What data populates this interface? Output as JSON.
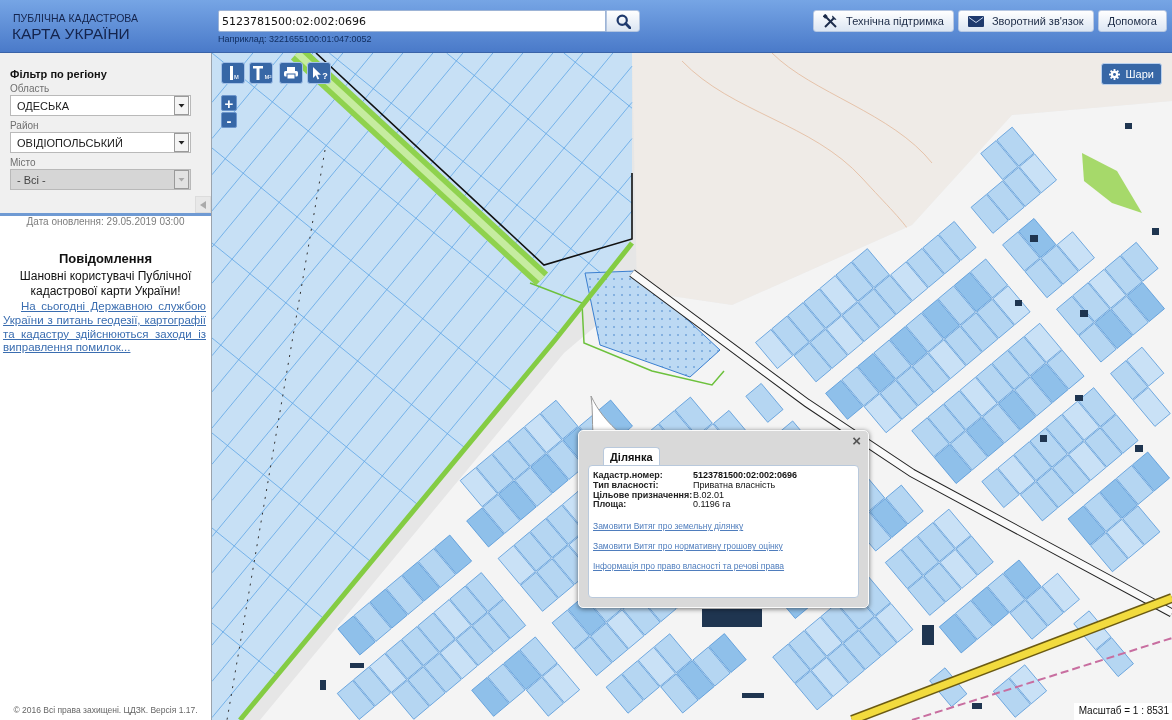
{
  "header": {
    "logo": {
      "line_1": "ПУБЛІЧНА КАДАСТРОВА",
      "line_2": "КАРТА УКРАЇНИ"
    },
    "search": {
      "value": "5123781500:02:002:0696",
      "hint": "Наприклад: 3221655100:01:047:0052"
    },
    "buttons": [
      {
        "kind": "tools",
        "label": "Технічна підтримка"
      },
      {
        "kind": "mail",
        "label": "Зворотний зв'язок"
      },
      {
        "kind": "plain",
        "label": "Допомога"
      }
    ]
  },
  "sidebar": {
    "filter_title": "Фільтр по регіону",
    "fields": [
      {
        "label": "Область",
        "value": "ОДЕСЬКА",
        "disabled": false
      },
      {
        "label": "Район",
        "value": "ОВІДІОПОЛЬСЬКИЙ",
        "disabled": false
      },
      {
        "label": "Місто",
        "value": "- Всі -",
        "disabled": true
      }
    ],
    "update_date": "Дата оновлення: 29.05.2019 03:00",
    "notice": {
      "title": "Повідомлення",
      "greeting": "Шановні користувачі Публічної кадастрової карти України!",
      "link": "На сьогодні Державною службою України з питань геодезії, картографії та кадастру здійснюються заходи із виправлення помилок..."
    },
    "footer": "© 2016 Всі права захищені. ЦДЗК. Версія 1.17."
  },
  "map": {
    "tools": [
      {
        "kind": "ruler",
        "label": "м"
      },
      {
        "kind": "area",
        "label": "м²"
      },
      {
        "kind": "print"
      },
      {
        "kind": "identify",
        "label": "?"
      }
    ],
    "zoom": [
      "+",
      "-"
    ],
    "layers_button": "Шари",
    "popup": {
      "close": "×",
      "tabs": [
        {
          "label": "Ділянка",
          "selected": true
        }
      ],
      "rows": [
        {
          "label": "Кадастр.номер:",
          "value": "5123781500:02:002:0696"
        },
        {
          "label": "Тип власності:",
          "value": "Приватна власність"
        },
        {
          "label": "Цільове призначення:",
          "value": "В.02.01"
        },
        {
          "label": "Площа:",
          "value": "0.1196 га"
        }
      ],
      "links": [
        "Замовити Витяг про земельну ділянку",
        "Замовити Витяг про нормативну грошову оцінку",
        "Інформація про право власності та речові права"
      ]
    },
    "scale": "Масштаб = 1 : 8531"
  }
}
